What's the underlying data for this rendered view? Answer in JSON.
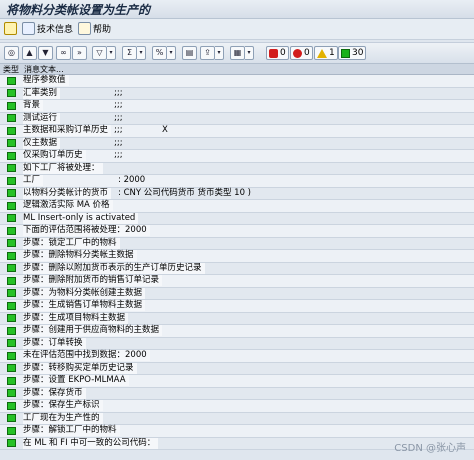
{
  "window": {
    "title": "将物料分类帐设置为生产的"
  },
  "appbar": {
    "tech_info": "技术信息",
    "help": "帮助"
  },
  "toolbar": {
    "counts": {
      "stop": "0",
      "error": "0",
      "warning": "1",
      "success": "30"
    }
  },
  "list": {
    "col_type": "类型",
    "col_message": "消息文本...",
    "rows": [
      {
        "text": "程序参数值"
      },
      {
        "text": "汇率类别",
        "c2": ";;;"
      },
      {
        "text": "背景",
        "c2": ";;;"
      },
      {
        "text": "测试运行",
        "c2": ";;;"
      },
      {
        "text": "主数据和采购订单历史",
        "c2": ";;;",
        "c3": "X"
      },
      {
        "text": "仅主数据",
        "c2": ";;;"
      },
      {
        "text": "仅采购订单历史",
        "c2": ";;;"
      },
      {
        "text": "如下工厂将被处理："
      },
      {
        "text": "工厂",
        "c2": ": 2000"
      },
      {
        "text": "以物料分类帐计的货币",
        "c2": ": CNY 公司代码货币 货币类型 10 )"
      },
      {
        "text": "逻辑激活实际 MA 价格"
      },
      {
        "text": "ML Insert-only is activated"
      },
      {
        "text": "下面的评估范围将被处理：2000"
      },
      {
        "text": "步骤：锁定工厂中的物料"
      },
      {
        "text": "步骤：删除物料分类帐主数据"
      },
      {
        "text": "步骤：删除以附加货币表示的生产订单历史记录"
      },
      {
        "text": "步骤：删除附加货币的销售订单记录"
      },
      {
        "text": "步骤：为物料分类帐创建主数据"
      },
      {
        "text": "步骤：生成销售订单物料主数据"
      },
      {
        "text": "步骤：生成项目物料主数据"
      },
      {
        "text": "步骤：创建用于供应商物料的主数据"
      },
      {
        "text": "步骤：订单转换"
      },
      {
        "text": "未在评估范围中找到数据：2000"
      },
      {
        "text": "步骤：转移购买定单历史记录"
      },
      {
        "text": "步骤：设置 EKPO-MLMAA"
      },
      {
        "text": "步骤：保存货币"
      },
      {
        "text": "步骤：保存生产标识"
      },
      {
        "text": "工厂现在为生产性的"
      },
      {
        "text": "步骤：解锁工厂中的物料"
      },
      {
        "text": "在 ML 和 FI 中可一致的公司代码："
      }
    ]
  },
  "watermark": "CSDN @张心声"
}
